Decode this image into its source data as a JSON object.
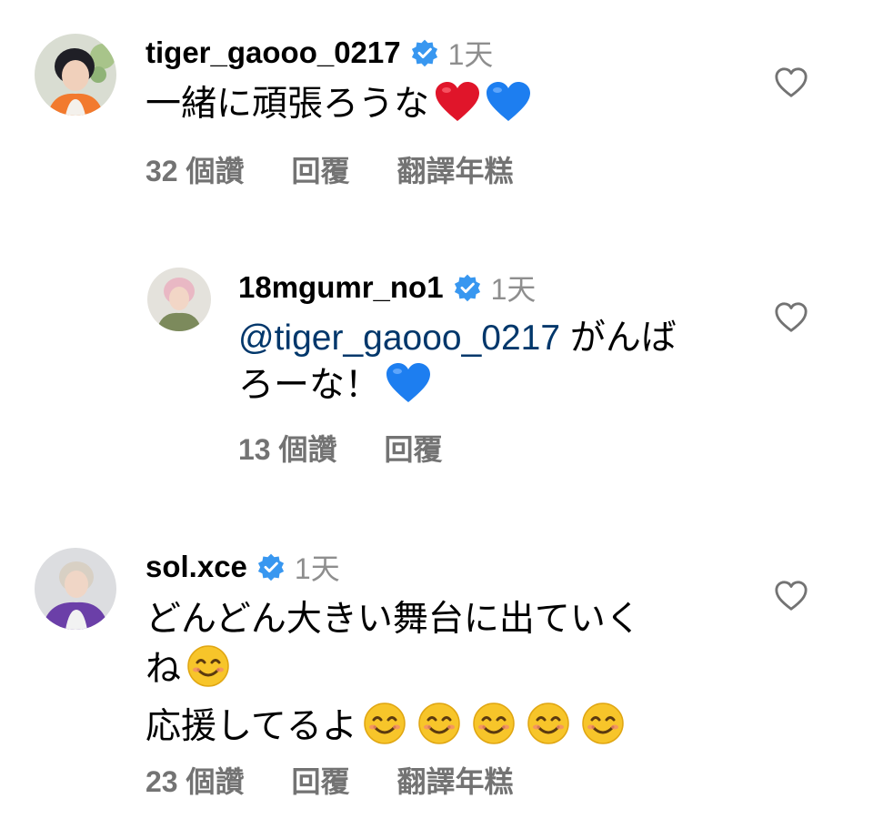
{
  "comments": [
    {
      "username": "tiger_gaooo_0217",
      "time": "1天",
      "text": "一緒に頑張ろうな",
      "emojis": [
        "red-heart",
        "blue-heart"
      ],
      "likes": "32 個讚",
      "reply": "回覆",
      "translate": "翻譯年糕"
    },
    {
      "username": "18mgumr_no1",
      "time": "1天",
      "mention": "@tiger_gaooo_0217",
      "text_line1": " がんば",
      "text_line2": "ろーな！",
      "emojis": [
        "blue-heart"
      ],
      "likes": "13 個讚",
      "reply": "回覆"
    },
    {
      "username": "sol.xce",
      "time": "1天",
      "text_line1": "どんどん大きい舞台に出ていく",
      "text_line2": "ね",
      "text_line3": "応援してるよ",
      "emojis": [
        "smiling-face",
        "smiling-face",
        "smiling-face",
        "smiling-face",
        "smiling-face",
        "smiling-face"
      ],
      "likes": "23 個讚",
      "reply": "回覆",
      "translate": "翻譯年糕"
    }
  ],
  "colors": {
    "username": "#000000",
    "meta": "#8e8e8e",
    "actions": "#737373",
    "mention": "#00376b",
    "verified": "#3897f0"
  }
}
